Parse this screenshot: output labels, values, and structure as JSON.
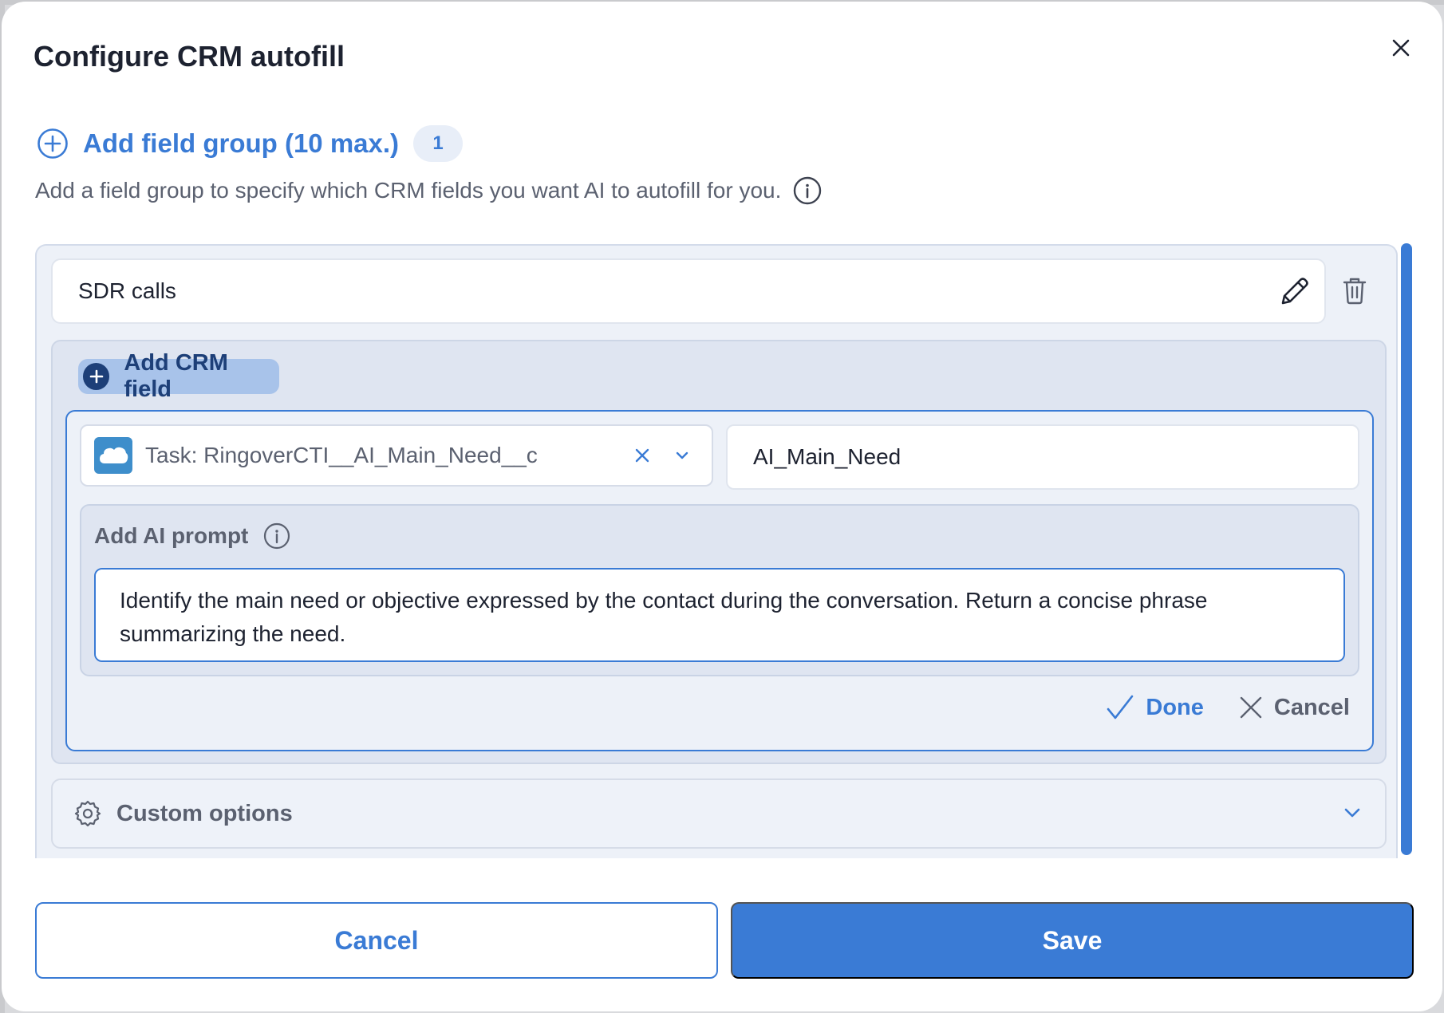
{
  "modal": {
    "title": "Configure CRM autofill"
  },
  "field_groups": {
    "add_label": "Add field group (10 max.)",
    "count": "1",
    "description": "Add a field group to specify which CRM fields you want AI to autofill for you."
  },
  "group": {
    "name": "SDR calls",
    "add_crm_field_label": "Add CRM field",
    "field": {
      "crm_field_value": "Task: RingoverCTI__AI_Main_Need__c",
      "crm_logo": "salesforce-cloud",
      "label_value": "AI_Main_Need",
      "prompt_title": "Add AI prompt",
      "prompt_text": "Identify the main need or objective expressed by the contact during the conversation. Return a concise phrase summarizing the need."
    },
    "done_label": "Done",
    "cancel_label": "Cancel",
    "custom_options_label": "Custom options"
  },
  "footer": {
    "cancel_label": "Cancel",
    "save_label": "Save"
  },
  "colors": {
    "accent": "#3a7bd5",
    "dark_accent": "#1d3f78",
    "text": "#1d2230",
    "muted": "#5b6170"
  }
}
